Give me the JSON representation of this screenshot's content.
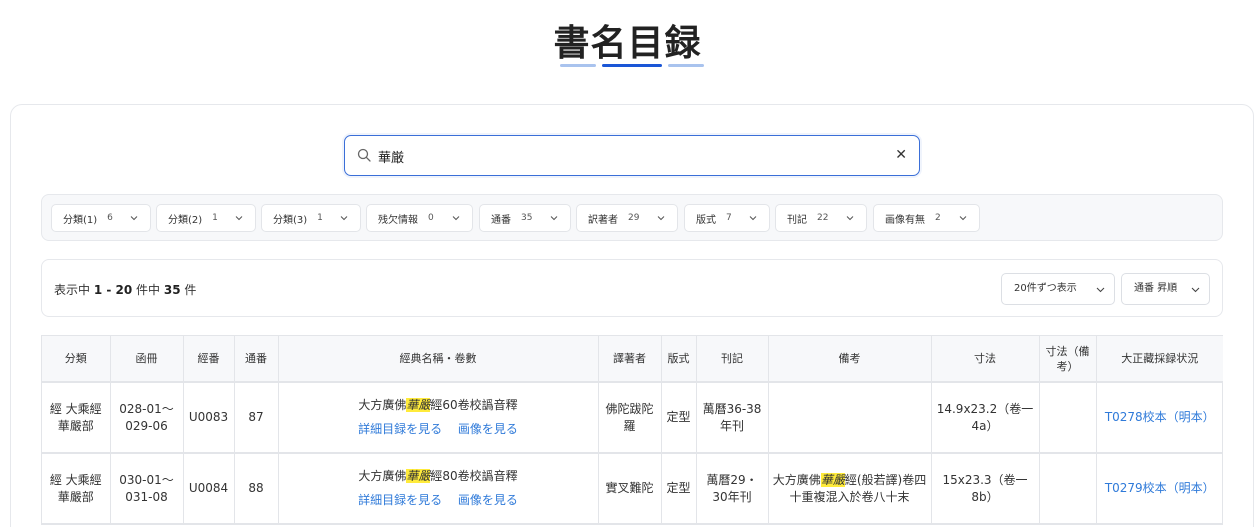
{
  "page": {
    "title": "書名目録"
  },
  "search": {
    "value": "華厳"
  },
  "filters": [
    {
      "label": "分類(1)",
      "count": "6"
    },
    {
      "label": "分類(2)",
      "count": "1"
    },
    {
      "label": "分類(3)",
      "count": "1"
    },
    {
      "label": "残欠情報",
      "count": "0"
    },
    {
      "label": "通番",
      "count": "35"
    },
    {
      "label": "訳著者",
      "count": "29"
    },
    {
      "label": "版式",
      "count": "7"
    },
    {
      "label": "刊記",
      "count": "22"
    },
    {
      "label": "画像有無",
      "count": "2"
    }
  ],
  "results": {
    "prefix": "表示中 ",
    "start": "1",
    "dash": " - ",
    "end": "20",
    "middle": " 件中 ",
    "total": "35",
    "suffix": " 件",
    "per_page": "20件ずつ表示",
    "sort": "通番 昇順"
  },
  "table": {
    "headers": {
      "category": "分類",
      "volume": "函冊",
      "sutra_no": "經番",
      "serial": "通番",
      "title": "經典名稱・卷數",
      "translator": "譯著者",
      "format": "版式",
      "colophon": "刊記",
      "notes": "備考",
      "size": "寸法",
      "size_notes": "寸法（備考）",
      "taisho": "大正藏採録状況"
    },
    "detail_link": "詳細目録を見る",
    "image_link": "画像を見る",
    "rows": [
      {
        "category": "經 大乘經華嚴部",
        "volume": "028-01～029-06",
        "sutra_no": "U0083",
        "serial": "87",
        "title_pre": "大方廣佛",
        "title_hl": "華嚴",
        "title_post": "經60卷校譌音釋",
        "translator": "佛陀跋陀羅",
        "format": "定型",
        "colophon": "萬曆36-38年刊",
        "notes_pre": "",
        "notes_hl": "",
        "notes_post": "",
        "size": "14.9x23.2（卷一4a）",
        "size_notes": "",
        "taisho": "T0278校本（明本）"
      },
      {
        "category": "經 大乘經華嚴部",
        "volume": "030-01～031-08",
        "sutra_no": "U0084",
        "serial": "88",
        "title_pre": "大方廣佛",
        "title_hl": "華嚴",
        "title_post": "經80卷校譌音釋",
        "translator": "實叉難陀",
        "format": "定型",
        "colophon": "萬曆29・30年刊",
        "notes_pre": "大方廣佛",
        "notes_hl": "華嚴",
        "notes_post": "經(般若譯)卷四十重複混入於卷八十末",
        "size": "15x23.3（卷一8b）",
        "size_notes": "",
        "taisho": "T0279校本（明本）"
      }
    ]
  },
  "colors": {
    "accent": "#1a56d6",
    "link": "#2f7ad9",
    "highlight": "#ffeb3b"
  }
}
